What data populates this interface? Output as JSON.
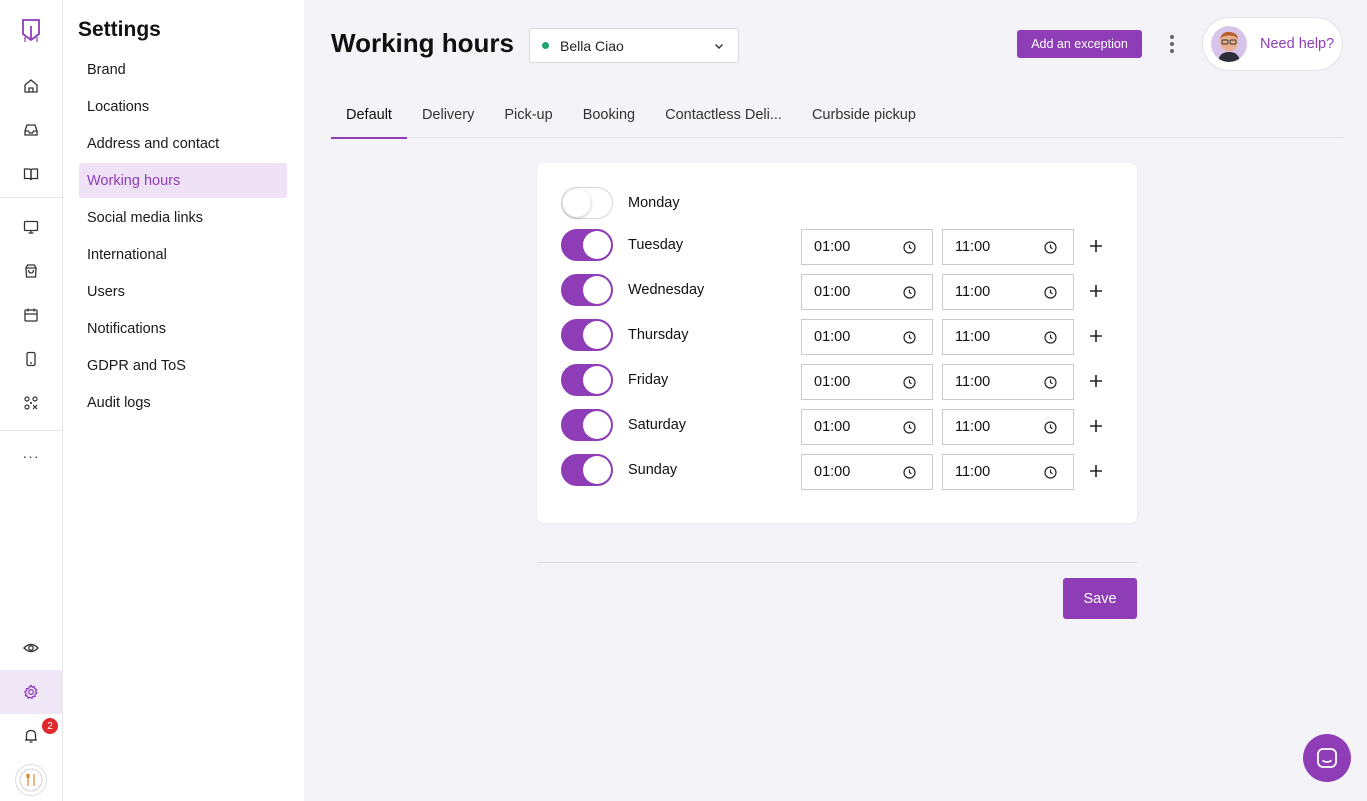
{
  "colors": {
    "accent": "#8e3db6",
    "status_open": "#1fa36b",
    "badge": "#e0282f"
  },
  "rail": {
    "icons": [
      "brand-logo-icon",
      "home-icon",
      "inbox-icon",
      "book-icon",
      "monitor-icon",
      "shopping-bag-icon",
      "calendar-icon",
      "smartphone-icon",
      "qr-code-icon",
      "more-icon",
      "eye-icon",
      "gear-icon",
      "bell-icon"
    ],
    "notifications_count": "2"
  },
  "settings": {
    "title": "Settings",
    "items": [
      {
        "label": "Brand"
      },
      {
        "label": "Locations"
      },
      {
        "label": "Address and contact"
      },
      {
        "label": "Working hours",
        "active": true
      },
      {
        "label": "Social media links"
      },
      {
        "label": "International"
      },
      {
        "label": "Users"
      },
      {
        "label": "Notifications"
      },
      {
        "label": "GDPR and ToS"
      },
      {
        "label": "Audit logs"
      }
    ]
  },
  "header": {
    "title": "Working hours",
    "location": "Bella Ciao",
    "add_exception_label": "Add an exception",
    "help_label": "Need help?"
  },
  "tabs": [
    {
      "label": "Default",
      "active": true
    },
    {
      "label": "Delivery"
    },
    {
      "label": "Pick-up"
    },
    {
      "label": "Booking"
    },
    {
      "label": "Contactless Deli..."
    },
    {
      "label": "Curbside pickup"
    }
  ],
  "days": [
    {
      "name": "Monday",
      "enabled": false
    },
    {
      "name": "Tuesday",
      "enabled": true,
      "start": "01:00",
      "end": "11:00"
    },
    {
      "name": "Wednesday",
      "enabled": true,
      "start": "01:00",
      "end": "11:00"
    },
    {
      "name": "Thursday",
      "enabled": true,
      "start": "01:00",
      "end": "11:00"
    },
    {
      "name": "Friday",
      "enabled": true,
      "start": "01:00",
      "end": "11:00"
    },
    {
      "name": "Saturday",
      "enabled": true,
      "start": "01:00",
      "end": "11:00"
    },
    {
      "name": "Sunday",
      "enabled": true,
      "start": "01:00",
      "end": "11:00"
    }
  ],
  "save_label": "Save"
}
